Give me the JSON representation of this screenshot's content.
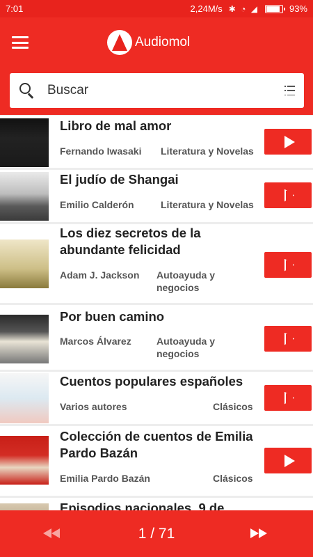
{
  "status_bar": {
    "time": "7:01",
    "network_speed": "2,24M/s",
    "battery_percent": "93%"
  },
  "app_bar": {
    "title": "Audiomol",
    "menu_icon": "hamburger-menu-icon",
    "logo_icon": "audiomol-logo-icon"
  },
  "search": {
    "placeholder": "Buscar",
    "value": ""
  },
  "books": [
    {
      "title": "Libro de mal amor",
      "author": "Fernando Iwasaki",
      "genre": "Literatura y Novelas",
      "play_style": "filled"
    },
    {
      "title": "El judío de Shangai",
      "author": "Emilio Calderón",
      "genre": "Literatura y Novelas",
      "play_style": "outline"
    },
    {
      "title": "Los diez secretos de la abundante felicidad",
      "author": "Adam J. Jackson",
      "genre": "Autoayuda y negocios",
      "play_style": "outline"
    },
    {
      "title": "Por buen camino",
      "author": "Marcos Álvarez",
      "genre": "Autoayuda y negocios",
      "play_style": "outline"
    },
    {
      "title": "Cuentos populares españoles",
      "author": "Varios autores",
      "genre": "Clásicos",
      "play_style": "outline"
    },
    {
      "title": "Colección de cuentos de Emilia Pardo Bazán",
      "author": "Emilia Pardo Bazán",
      "genre": "Clásicos",
      "play_style": "filled"
    },
    {
      "title": "Episodios nacionales. 9 de",
      "author": "",
      "genre": "",
      "play_style": "outline"
    }
  ],
  "pagination": {
    "current_page": 1,
    "total_pages": 71,
    "label": "1 / 71"
  },
  "colors": {
    "primary": "#ee2b23",
    "status_bar": "#e8231d",
    "background": "#ededed"
  }
}
